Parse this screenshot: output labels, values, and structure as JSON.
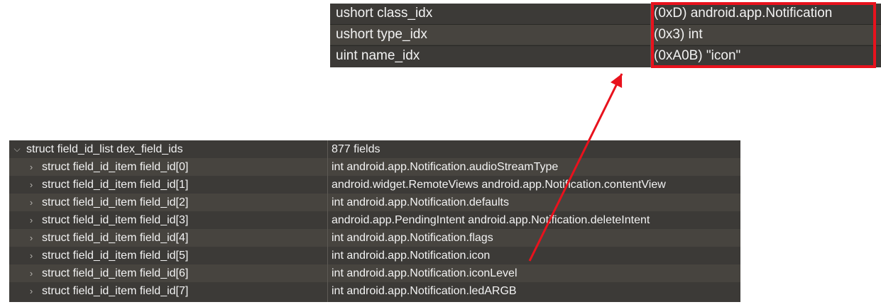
{
  "detail": {
    "rows": [
      {
        "name": "ushort class_idx",
        "value": "(0xD) android.app.Notification"
      },
      {
        "name": "ushort type_idx",
        "value": "(0x3) int"
      },
      {
        "name": "uint name_idx",
        "value": "(0xA0B) \"icon\""
      }
    ]
  },
  "list": {
    "root": {
      "name": "struct field_id_list dex_field_ids",
      "value": "877 fields"
    },
    "items": [
      {
        "name": "struct field_id_item field_id[0]",
        "value": "int android.app.Notification.audioStreamType"
      },
      {
        "name": "struct field_id_item field_id[1]",
        "value": "android.widget.RemoteViews android.app.Notification.contentView"
      },
      {
        "name": "struct field_id_item field_id[2]",
        "value": "int android.app.Notification.defaults"
      },
      {
        "name": "struct field_id_item field_id[3]",
        "value": "android.app.PendingIntent android.app.Notification.deleteIntent"
      },
      {
        "name": "struct field_id_item field_id[4]",
        "value": "int android.app.Notification.flags"
      },
      {
        "name": "struct field_id_item field_id[5]",
        "value": "int android.app.Notification.icon"
      },
      {
        "name": "struct field_id_item field_id[6]",
        "value": "int android.app.Notification.iconLevel"
      },
      {
        "name": "struct field_id_item field_id[7]",
        "value": "int android.app.Notification.ledARGB"
      }
    ]
  },
  "annotation": {
    "color": "#e8121d"
  },
  "icons": {
    "expanded": "chevron-down-icon",
    "collapsed": "chevron-right-icon"
  }
}
